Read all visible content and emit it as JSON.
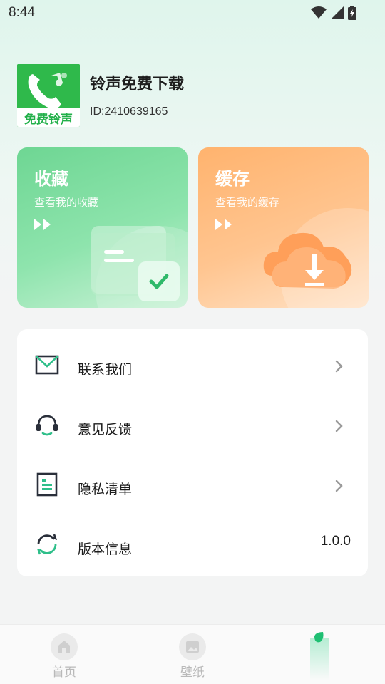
{
  "status_bar": {
    "time": "8:44"
  },
  "profile": {
    "logo_text": "免费铃声",
    "app_name": "铃声免费下载",
    "id_text": "ID:2410639165"
  },
  "cards": [
    {
      "title": "收藏",
      "subtitle": "查看我的收藏",
      "accent": "#6ed693"
    },
    {
      "title": "缓存",
      "subtitle": "查看我的缓存",
      "accent": "#ffb36e"
    }
  ],
  "menu": {
    "items": [
      {
        "label": "联系我们",
        "icon": "mail-icon"
      },
      {
        "label": "意见反馈",
        "icon": "headset-icon"
      },
      {
        "label": "隐私清单",
        "icon": "document-list-icon"
      },
      {
        "label": "版本信息",
        "icon": "refresh-icon",
        "value": "1.0.0"
      }
    ]
  },
  "bottom_nav": {
    "items": [
      {
        "label": "首页",
        "icon": "home-icon"
      },
      {
        "label": "壁纸",
        "icon": "image-icon"
      },
      {
        "label": "",
        "icon": "profile-leaf-icon",
        "active": true
      }
    ]
  },
  "colors": {
    "brand_green": "#2db24a",
    "active_tab": "#22c77a"
  }
}
